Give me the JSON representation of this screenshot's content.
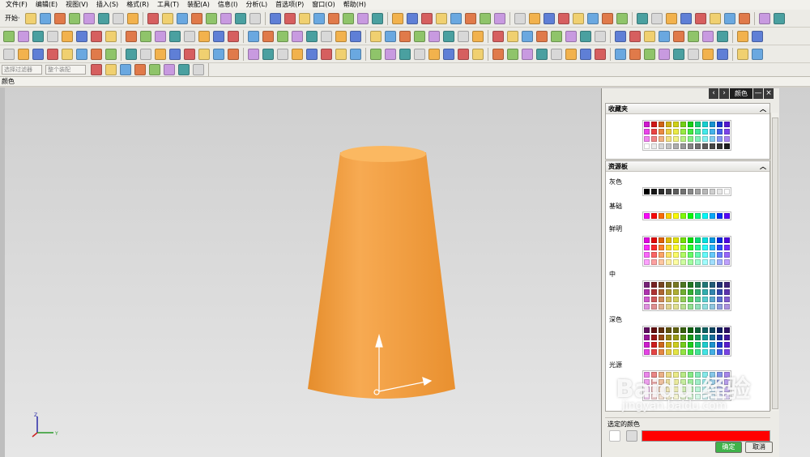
{
  "menu": [
    "文件(F)",
    "编辑(E)",
    "视图(V)",
    "插入(S)",
    "格式(R)",
    "工具(T)",
    "装配(A)",
    "信息(I)",
    "分析(L)",
    "首选项(P)",
    "窗口(O)",
    "帮助(H)"
  ],
  "toolbar": {
    "start_label": "开始·",
    "filter_placeholder": "选择过滤器",
    "assembly_placeholder": "整个装配"
  },
  "window_title": "颜色",
  "dialog": {
    "title": "颜色",
    "favorites_label": "收藏夹",
    "palette_label": "资源板",
    "groups": [
      "灰色",
      "基础",
      "鲜明",
      "中",
      "深色",
      "光源"
    ],
    "selected_label": "选定的颜色",
    "ok_label": "确定",
    "cancel_label": "取消",
    "selected_color": "#ff0000"
  },
  "model_color": "#f5a447",
  "watermark": {
    "brand": "Baidu 经验",
    "url": "jingyan.baidu.com"
  },
  "axes": {
    "z": "Z",
    "y": "Y",
    "x": "X"
  }
}
